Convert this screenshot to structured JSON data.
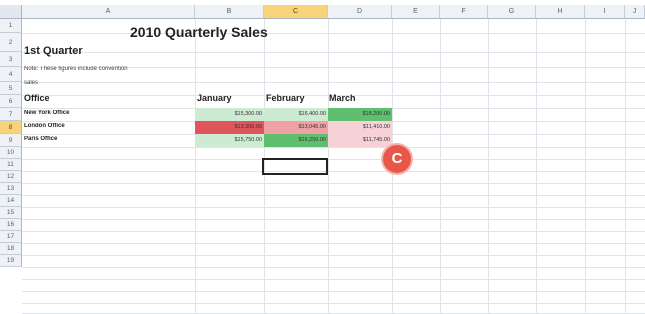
{
  "columns": [
    "A",
    "B",
    "C",
    "D",
    "E",
    "F",
    "G",
    "H",
    "I",
    "J"
  ],
  "selected_column": "C",
  "rows": [
    "1",
    "2",
    "3",
    "4",
    "5",
    "6",
    "7",
    "8",
    "9",
    "10",
    "11",
    "12",
    "13",
    "14",
    "15",
    "16",
    "17",
    "18",
    "19"
  ],
  "selected_row": "8",
  "sheet": {
    "title": "2010 Quarterly Sales",
    "quarter": "1st Quarter",
    "note_line1": "Note: These figures include convention",
    "note_line2": "sales",
    "header_office": "Office",
    "months": [
      "January",
      "February",
      "March"
    ],
    "offices": [
      {
        "name": "New York Office",
        "values": [
          "$15,300.00",
          "$16,400.00",
          "$18,200.00"
        ]
      },
      {
        "name": "London Office",
        "values": [
          "$13,300.00",
          "$13,045.00",
          "$11,410.00"
        ]
      },
      {
        "name": "Paris Office",
        "values": [
          "$15,750.00",
          "$16,250.00",
          "$11,745.00"
        ]
      }
    ]
  },
  "colors": {
    "green_dark": "#5fbf6f",
    "green_light": "#cdebd2",
    "red_dark": "#e0555c",
    "red_light": "#f0a1a6",
    "pink_light": "#f6d2d6"
  },
  "callout": {
    "label": "C"
  }
}
